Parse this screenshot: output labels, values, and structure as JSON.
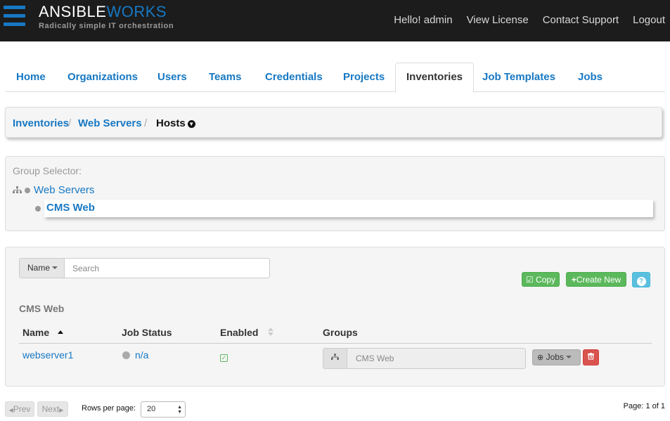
{
  "header": {
    "brand_part1": "ANSIBLE",
    "brand_part2": "WORKS",
    "tagline": "Radically simple IT orchestration",
    "links": [
      "Hello! admin",
      "View License",
      "Contact Support",
      "Logout"
    ]
  },
  "tabs": [
    "Home",
    "Organizations",
    "Users",
    "Teams",
    "Credentials",
    "Projects",
    "Inventories",
    "Job Templates",
    "Jobs"
  ],
  "active_tab": "Inventories",
  "breadcrumb": {
    "items": [
      "Inventories",
      "Web Servers"
    ],
    "separator": "/",
    "current": "Hosts"
  },
  "group_selector": {
    "label": "Group Selector:",
    "groups": [
      "Web Servers",
      "CMS Web"
    ],
    "selected": "CMS Web"
  },
  "search": {
    "field_label": "Name",
    "placeholder": "Search"
  },
  "actions": {
    "copy": "Copy",
    "create_new": "Create New",
    "help": "?"
  },
  "section_title": "CMS Web",
  "table": {
    "columns": [
      "Name",
      "Job Status",
      "Enabled",
      "Groups"
    ],
    "rows": [
      {
        "name": "webserver1",
        "job_status": "n/a",
        "enabled": true,
        "groups": "CMS Web",
        "jobs_label": "Jobs"
      }
    ]
  },
  "pagination": {
    "prev": "Prev",
    "next": "Next",
    "rows_label": "Rows per page:",
    "rows_value": "20",
    "page_info": "Page: 1 of 1"
  },
  "colors": {
    "brand_blue": "#1778c3",
    "header_bg": "#1c1c1c",
    "success_green": "#5cb85c",
    "info_blue": "#5bc0de",
    "danger_red": "#d9534f"
  },
  "icons": [
    "menu-icon",
    "tree-icon",
    "chevron-circle-down-icon",
    "check-square-icon",
    "plus-icon",
    "question-icon",
    "sitemap-icon",
    "search-plus-icon",
    "trash-icon",
    "sort-up-icon",
    "sort-icon",
    "caret-left-icon",
    "caret-right-icon"
  ]
}
